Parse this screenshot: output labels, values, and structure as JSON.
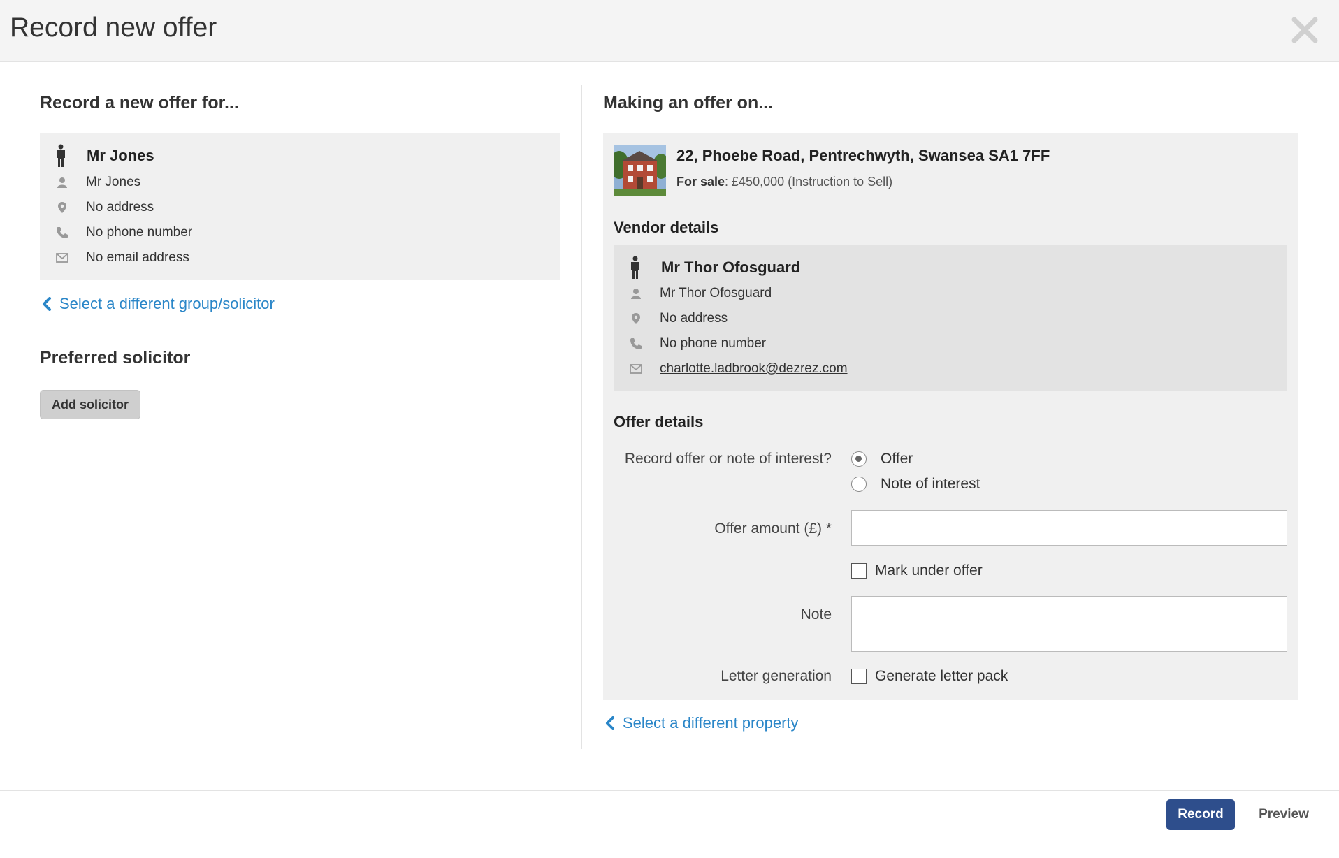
{
  "modal": {
    "title": "Record new offer"
  },
  "left": {
    "heading": "Record a new offer for...",
    "applicant": {
      "name": "Mr Jones",
      "contact_link": "Mr Jones",
      "address": "No address",
      "phone": "No phone number",
      "email": "No email address"
    },
    "back_link": "Select a different group/solicitor",
    "solicitor_heading": "Preferred solicitor",
    "add_solicitor_label": "Add solicitor"
  },
  "right": {
    "heading": "Making an offer on...",
    "property": {
      "address": "22, Phoebe Road, Pentrechwyth, Swansea SA1 7FF",
      "status_label": "For sale",
      "price_text": ": £450,000 (Instruction to Sell)"
    },
    "vendor_heading": "Vendor details",
    "vendor": {
      "name": "Mr Thor Ofosguard",
      "contact_link": "Mr Thor Ofosguard",
      "address": "No address",
      "phone": "No phone number",
      "email": "charlotte.ladbrook@dezrez.com"
    },
    "offer_heading": "Offer details",
    "offer_form": {
      "type_label": "Record offer or note of interest?",
      "type_options": [
        "Offer",
        "Note of interest"
      ],
      "type_selected": "Offer",
      "amount_label": "Offer amount (£) *",
      "amount_value": "",
      "mark_under_offer_label": "Mark under offer",
      "note_label": "Note",
      "note_value": "",
      "letter_label": "Letter generation",
      "letter_checkbox_label": "Generate letter pack"
    },
    "back_link": "Select a different property"
  },
  "footer": {
    "record_label": "Record",
    "preview_label": "Preview"
  },
  "icons": {
    "close": "close-icon",
    "person": "person-icon",
    "user": "user-icon",
    "location": "map-pin-icon",
    "phone": "phone-icon",
    "email": "envelope-icon",
    "back": "chevron-left-icon"
  },
  "colors": {
    "link": "#2a86c8",
    "primary": "#2e4e8c",
    "panel": "#f0f0f0",
    "panel_dark": "#e3e3e3"
  }
}
